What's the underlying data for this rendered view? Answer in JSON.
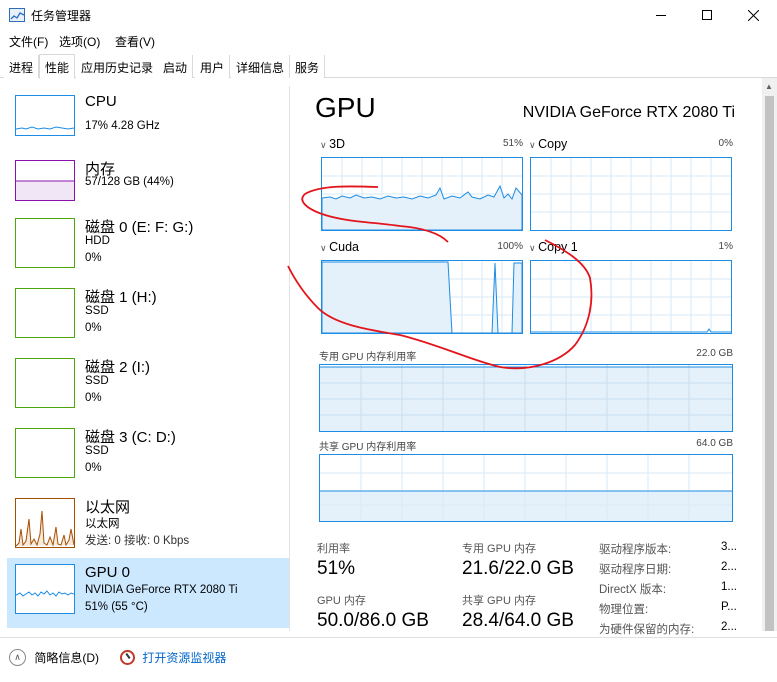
{
  "window": {
    "title": "任务管理器"
  },
  "menu": [
    "文件(F)",
    "选项(O)",
    "查看(V)"
  ],
  "tabs": [
    "进程",
    "性能",
    "应用历史记录",
    "启动",
    "用户",
    "详细信息",
    "服务"
  ],
  "sidebar": {
    "items": [
      {
        "title": "CPU",
        "line1": "17% 4.28 GHz",
        "line2": "",
        "line3": ""
      },
      {
        "title": "内存",
        "line1": "57/128 GB (44%)",
        "line2": "",
        "line3": ""
      },
      {
        "title": "磁盘 0 (E: F: G:)",
        "line1": "HDD",
        "line2": "0%",
        "line3": ""
      },
      {
        "title": "磁盘 1 (H:)",
        "line1": "SSD",
        "line2": "0%",
        "line3": ""
      },
      {
        "title": "磁盘 2 (I:)",
        "line1": "SSD",
        "line2": "0%",
        "line3": ""
      },
      {
        "title": "磁盘 3 (C: D:)",
        "line1": "SSD",
        "line2": "0%",
        "line3": ""
      },
      {
        "title": "以太网",
        "line1": "以太网",
        "line2": "发送: 0 接收: 0 Kbps",
        "line3": ""
      },
      {
        "title": "GPU 0",
        "line1": "NVIDIA GeForce RTX 2080 Ti",
        "line2": "51% (55 °C)",
        "line3": ""
      }
    ]
  },
  "main": {
    "heading": "GPU",
    "model": "NVIDIA GeForce RTX 2080 Ti",
    "engines": [
      {
        "name": "3D",
        "percent": "51%"
      },
      {
        "name": "Copy",
        "percent": "0%"
      },
      {
        "name": "Cuda",
        "percent": "100%"
      },
      {
        "name": "Copy 1",
        "percent": "1%"
      }
    ],
    "dedicated_label": "专用 GPU 内存利用率",
    "dedicated_max": "22.0 GB",
    "shared_label": "共享 GPU 内存利用率",
    "shared_max": "64.0 GB",
    "stats": {
      "utilization_label": "利用率",
      "utilization_value": "51%",
      "dedicated_mem_label": "专用 GPU 内存",
      "dedicated_mem_value": "21.6/22.0 GB",
      "gpu_mem_label": "GPU 内存",
      "gpu_mem_value": "50.0/86.0 GB",
      "shared_mem_label": "共享 GPU 内存",
      "shared_mem_value": "28.4/64.0 GB"
    },
    "info": [
      {
        "label": "驱动程序版本:",
        "value": "3..."
      },
      {
        "label": "驱动程序日期:",
        "value": "2..."
      },
      {
        "label": "DirectX 版本:",
        "value": "1..."
      },
      {
        "label": "物理位置:",
        "value": "P..."
      },
      {
        "label": "为硬件保留的内存:",
        "value": "2..."
      }
    ]
  },
  "footer": {
    "summary_label": "简略信息(D)",
    "monitor_label": "打开资源监视器"
  },
  "colors": {
    "accent": "#1c8ce5",
    "memory": "#8b12ae",
    "ethernet": "#a74f01",
    "disk": "#4da60c",
    "selected": "#cce8ff",
    "annotation": "#e3141b"
  }
}
